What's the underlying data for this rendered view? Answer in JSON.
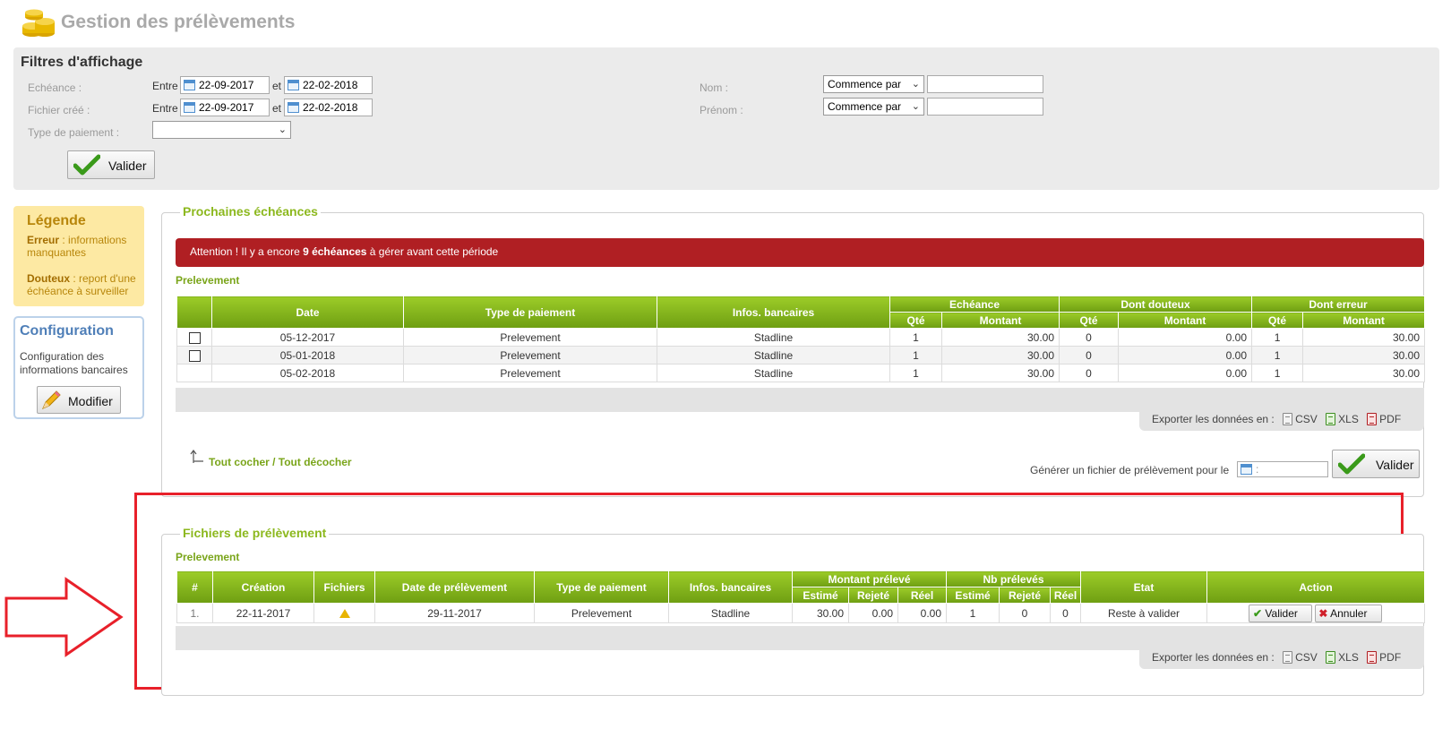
{
  "page_title": "Gestion des prélèvements",
  "colors": {
    "accent_green": "#8cb81e",
    "alert_red": "#b01f23",
    "legend_yellow": "#fde9a3",
    "highlight_red": "#e8202a"
  },
  "filters": {
    "title": "Filtres d'affichage",
    "echeance_label": "Echéance :",
    "fichier_label": "Fichier créé :",
    "type_label": "Type de paiement :",
    "between": "Entre",
    "and": "et",
    "echeance_from": "22-09-2017",
    "echeance_to": "22-02-2018",
    "fichier_from": "22-09-2017",
    "fichier_to": "22-02-2018",
    "type_value": "",
    "nom_label": "Nom :",
    "prenom_label": "Prénom :",
    "nom_mode": "Commence par",
    "prenom_mode": "Commence par",
    "nom_value": "",
    "prenom_value": "",
    "submit": "Valider"
  },
  "legend": {
    "title": "Légende",
    "erreur_key": "Erreur",
    "erreur_text": " : informations manquantes",
    "douteux_key": "Douteux",
    "douteux_text": " : report d'une échéance à surveiller"
  },
  "config": {
    "title": "Configuration",
    "text": "Configuration des informations bancaires",
    "button": "Modifier"
  },
  "upcoming": {
    "legend": "Prochaines échéances",
    "alert_prefix": "Attention ! Il y a encore ",
    "alert_bold": "9 échéances",
    "alert_suffix": " à gérer avant cette période",
    "subtitle": "Prelevement",
    "headers": {
      "date": "Date",
      "type": "Type de paiement",
      "bank": "Infos. bancaires",
      "echeance": "Echéance",
      "douteux": "Dont douteux",
      "erreur": "Dont erreur",
      "qte": "Qté",
      "montant": "Montant"
    },
    "rows": [
      {
        "date": "05-12-2017",
        "type": "Prelevement",
        "bank": "Stadline",
        "e_qte": "1",
        "e_mt": "30.00",
        "d_qte": "0",
        "d_mt": "0.00",
        "r_qte": "1",
        "r_mt": "30.00"
      },
      {
        "date": "05-01-2018",
        "type": "Prelevement",
        "bank": "Stadline",
        "e_qte": "1",
        "e_mt": "30.00",
        "d_qte": "0",
        "d_mt": "0.00",
        "r_qte": "1",
        "r_mt": "30.00"
      },
      {
        "date": "05-02-2018",
        "type": "Prelevement",
        "bank": "Stadline",
        "e_qte": "1",
        "e_mt": "30.00",
        "d_qte": "0",
        "d_mt": "0.00",
        "r_qte": "1",
        "r_mt": "30.00"
      }
    ],
    "export_label": "Exporter les données en :",
    "csv": "CSV",
    "xls": "XLS",
    "pdf": "PDF",
    "toggle_all": "Tout cocher / Tout décocher",
    "generate_label": "Générer un fichier de prélèvement pour le",
    "generate_date": ":",
    "generate_button": "Valider"
  },
  "files": {
    "legend": "Fichiers de prélèvement",
    "subtitle": "Prelevement",
    "headers": {
      "num": "#",
      "creation": "Création",
      "fichiers": "Fichiers",
      "date_prelev": "Date de prélèvement",
      "type": "Type de paiement",
      "bank": "Infos. bancaires",
      "montant": "Montant prélevé",
      "nb": "Nb prélevés",
      "estime": "Estimé",
      "rejete": "Rejeté",
      "reel": "Réel",
      "etat": "Etat",
      "action": "Action"
    },
    "rows": [
      {
        "num": "1.",
        "creation": "22-11-2017",
        "date_prelev": "29-11-2017",
        "type": "Prelevement",
        "bank": "Stadline",
        "m_est": "30.00",
        "m_rej": "0.00",
        "m_reel": "0.00",
        "n_est": "1",
        "n_rej": "0",
        "n_reel": "0",
        "etat": "Reste à valider",
        "valider": "Valider",
        "annuler": "Annuler"
      }
    ],
    "export_label": "Exporter les données en :",
    "csv": "CSV",
    "xls": "XLS",
    "pdf": "PDF"
  }
}
